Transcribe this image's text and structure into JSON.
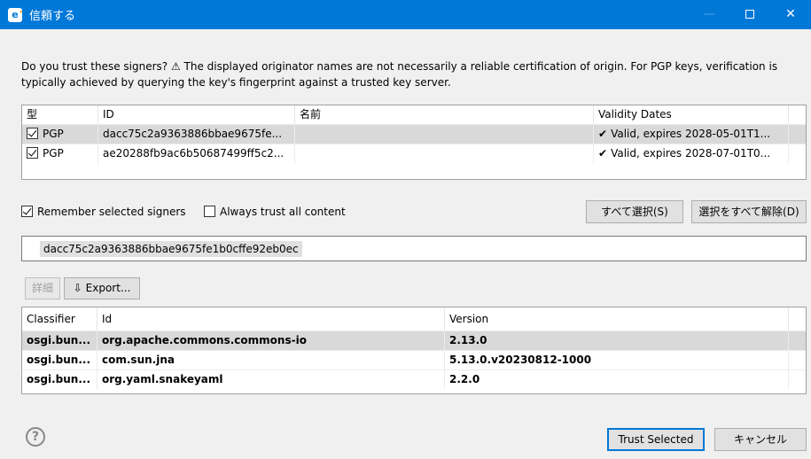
{
  "window": {
    "title": "信頼する",
    "app_icon": "e",
    "app_icon_sup": "•",
    "minimize": "—",
    "close": "✕"
  },
  "message": "Do you trust these signers? ⚠ The displayed originator names are not necessarily a reliable certification of origin.  For PGP keys, verification is typically achieved by querying the key's fingerprint against a trusted key server.",
  "signers_table": {
    "headers": [
      "型",
      "ID",
      "名前",
      "Validity Dates"
    ],
    "rows": [
      {
        "checked": true,
        "type": "PGP",
        "id": "dacc75c2a9363886bbae9675fe...",
        "name": "",
        "validity_check": "✔",
        "validity": "Valid, expires 2028-05-01T1..."
      },
      {
        "checked": true,
        "type": "PGP",
        "id": "ae20288fb9ac6b50687499ff5c2...",
        "name": "",
        "validity_check": "✔",
        "validity": "Valid, expires 2028-07-01T0..."
      }
    ]
  },
  "options": {
    "remember_label": "Remember selected signers",
    "remember_checked": true,
    "always_trust_label": "Always trust all content",
    "always_trust_checked": false
  },
  "buttons": {
    "select_all": "すべて選択(S)",
    "deselect_all": "選択をすべて解除(D)",
    "details": "詳細",
    "export": "Export...",
    "trust_selected": "Trust Selected",
    "cancel": "キャンセル"
  },
  "fingerprint": "dacc75c2a9363886bbae9675fe1b0cffe92eb0ec",
  "artifacts_table": {
    "headers": [
      "Classifier",
      "Id",
      "Version"
    ],
    "rows": [
      {
        "classifier": "osgi.bun...",
        "id": "org.apache.commons.commons-io",
        "version": "2.13.0"
      },
      {
        "classifier": "osgi.bun...",
        "id": "com.sun.jna",
        "version": "5.13.0.v20230812-1000"
      },
      {
        "classifier": "osgi.bun...",
        "id": "org.yaml.snakeyaml",
        "version": "2.2.0"
      }
    ]
  },
  "help_icon": "?",
  "export_icon": "⇩"
}
